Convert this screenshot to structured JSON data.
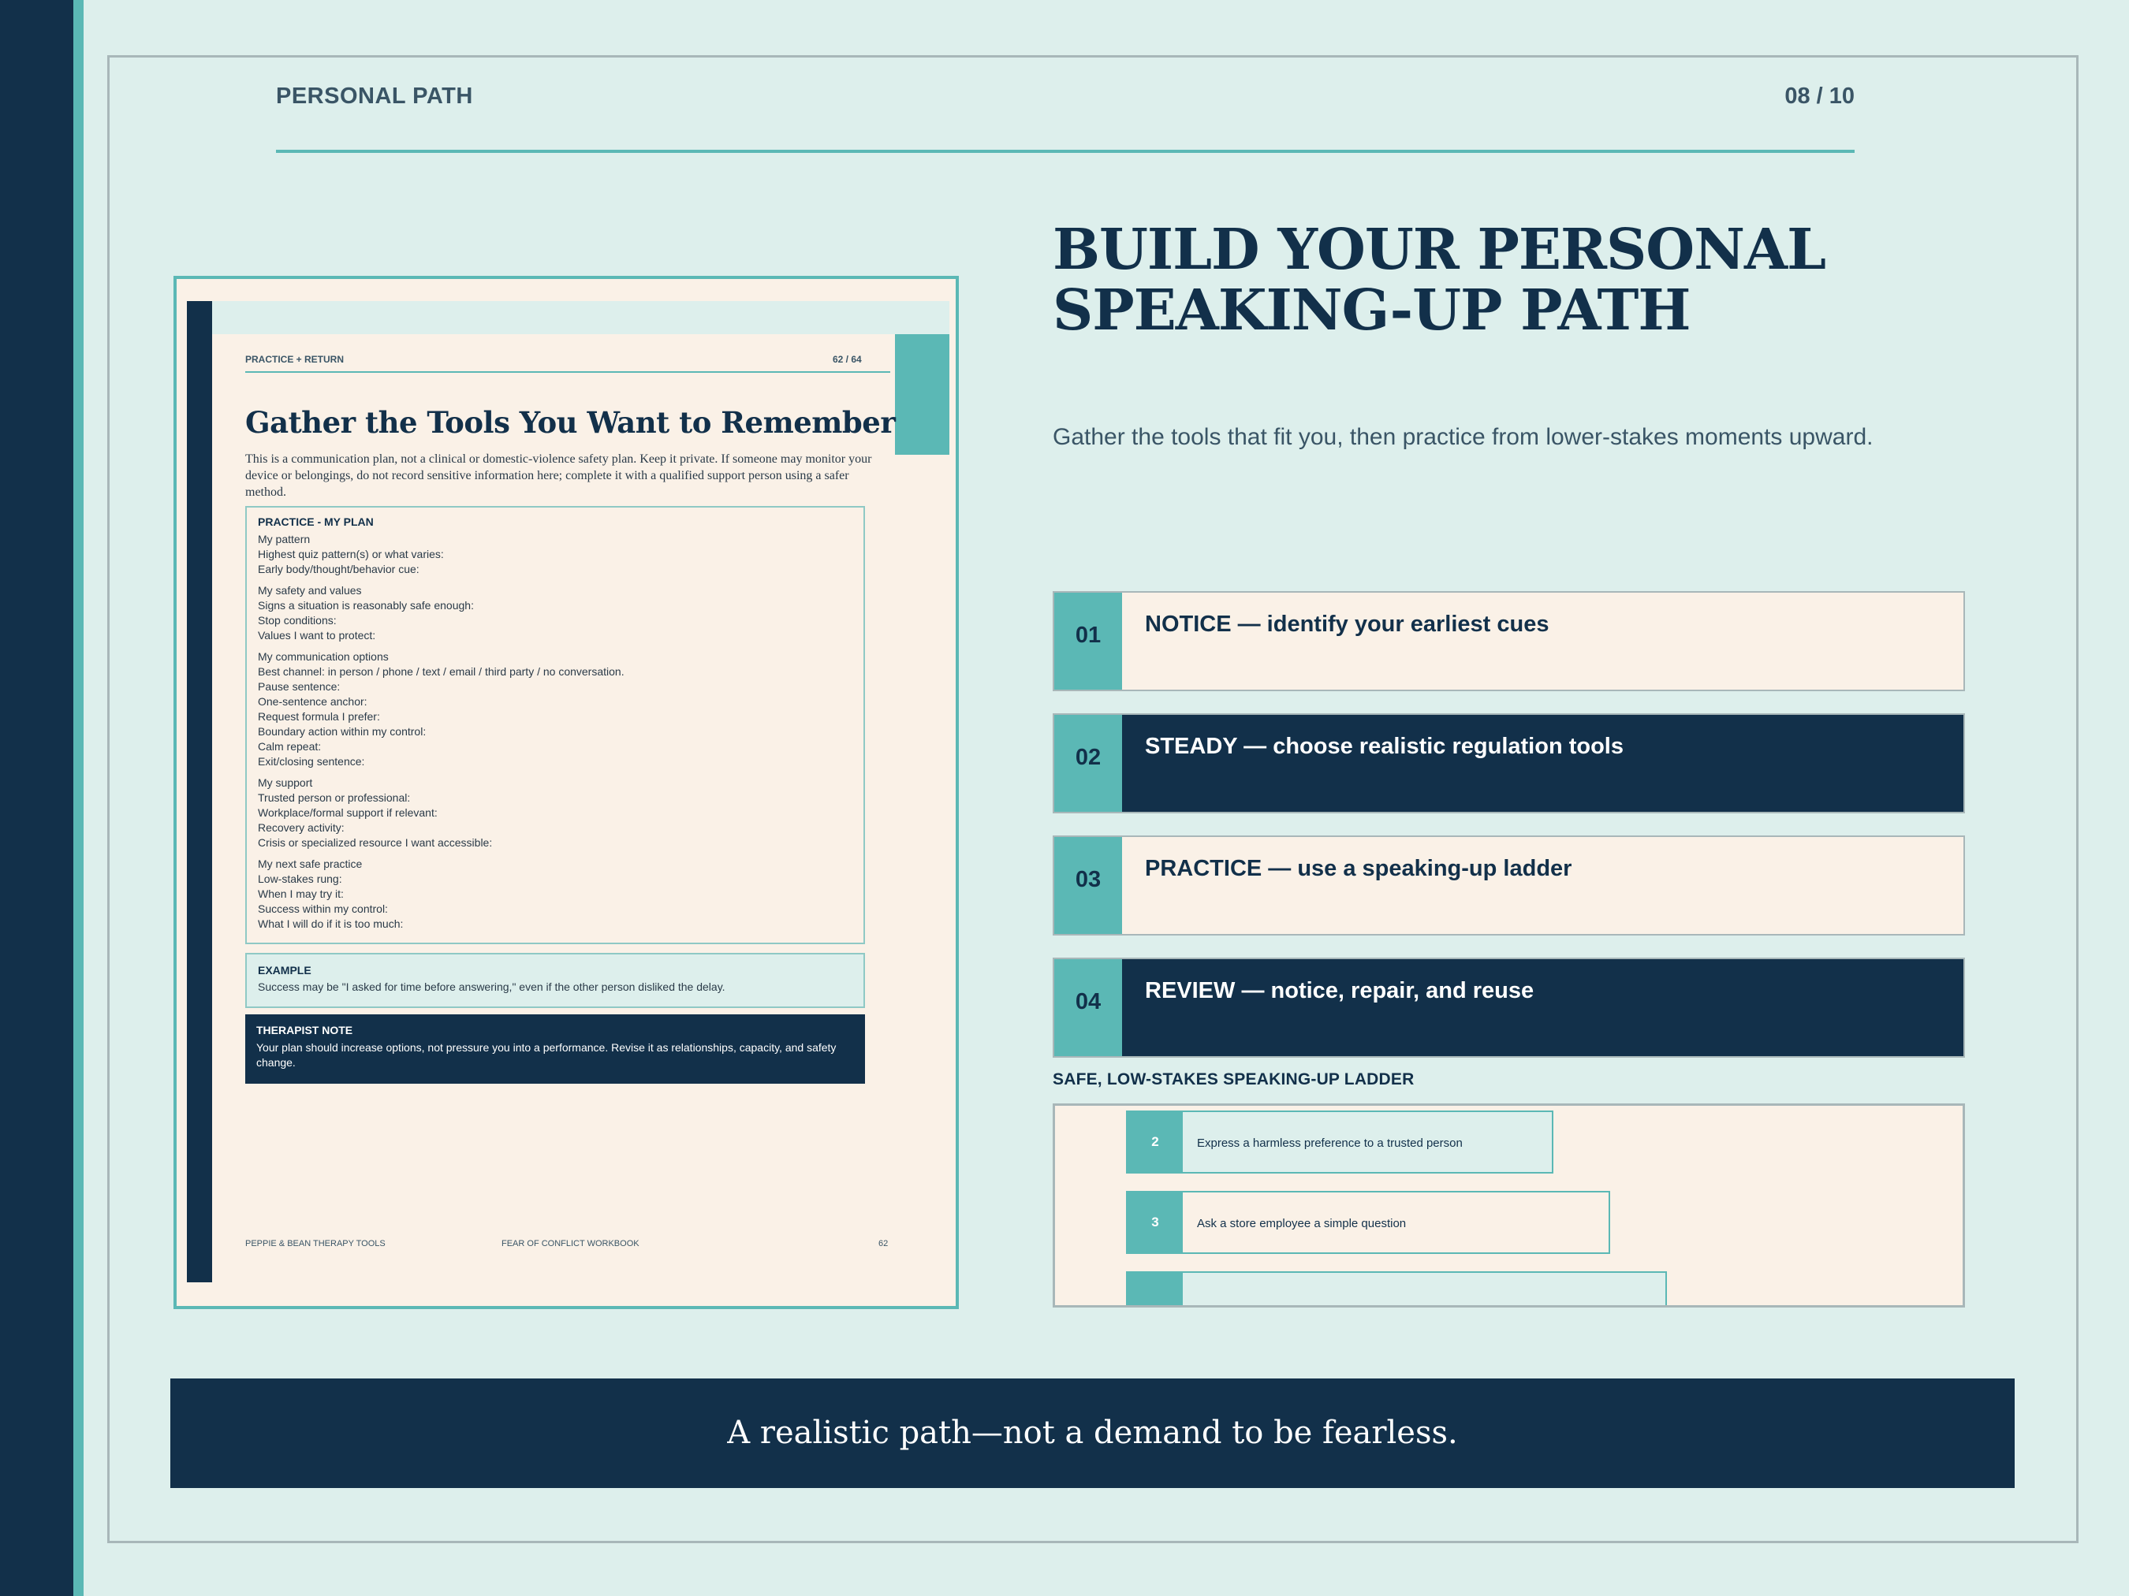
{
  "header": {
    "section": "PERSONAL PATH",
    "page": "08 / 10"
  },
  "thumbnail": {
    "kicker": "PRACTICE + RETURN",
    "page": "62 / 64",
    "title": "Gather the Tools You Want to Remember",
    "intro": "This is a communication plan, not a clinical or domestic-violence safety plan. Keep it private. If someone may monitor your device or belongings, do not record sensitive information here; complete it with a qualified support person using a safer method.",
    "plan_heading": "PRACTICE - MY PLAN",
    "groups": [
      [
        "My pattern",
        "Highest quiz pattern(s) or what varies:",
        "Early body/thought/behavior cue:"
      ],
      [
        "My safety and values",
        "Signs a situation is reasonably safe enough:",
        "Stop conditions:",
        "Values I want to protect:"
      ],
      [
        "My communication options",
        "Best channel: in person / phone / text / email / third party / no conversation.",
        "Pause sentence:",
        "One-sentence anchor:",
        "Request formula I prefer:",
        "Boundary action within my control:",
        "Calm repeat:",
        "Exit/closing sentence:"
      ],
      [
        "My support",
        "Trusted person or professional:",
        "Workplace/formal support if relevant:",
        "Recovery activity:",
        "Crisis or specialized resource I want accessible:"
      ],
      [
        "My next safe practice",
        "Low-stakes rung:",
        "When I may try it:",
        "Success within my control:",
        "What I will do if it is too much:"
      ]
    ],
    "example_heading": "EXAMPLE",
    "example_text": "Success may be \"I asked for time before answering,\" even if the other person disliked the delay.",
    "note_heading": "THERAPIST NOTE",
    "note_text": "Your plan should increase options, not pressure you into a performance. Revise it as relationships, capacity, and safety change.",
    "footer_left": "PEPPIE & BEAN THERAPY TOOLS",
    "footer_center": "FEAR OF CONFLICT WORKBOOK",
    "footer_right": "62"
  },
  "main": {
    "title_line1": "BUILD YOUR PERSONAL",
    "title_line2": "SPEAKING-UP PATH",
    "subtitle": "Gather the tools that fit you, then practice from lower-stakes moments upward.",
    "steps": [
      {
        "num": "01",
        "label": "NOTICE — identify your earliest cues"
      },
      {
        "num": "02",
        "label": "STEADY — choose realistic regulation tools"
      },
      {
        "num": "03",
        "label": "PRACTICE — use a speaking-up ladder"
      },
      {
        "num": "04",
        "label": "REVIEW — notice, repair, and reuse"
      }
    ],
    "ladder_heading": "SAFE, LOW-STAKES SPEAKING-UP LADDER",
    "rungs": [
      {
        "num": "2",
        "text": "Express a harmless preference to a trusted person"
      },
      {
        "num": "3",
        "text": "Ask a store employee a simple question"
      },
      {
        "num": "",
        "text": ""
      }
    ]
  },
  "banner": "A realistic path—not a demand to be fearless.",
  "colors": {
    "navy": "#12304a",
    "teal": "#5bb8b5",
    "mint_bg": "#ddefec",
    "cream": "#faf1e7"
  }
}
